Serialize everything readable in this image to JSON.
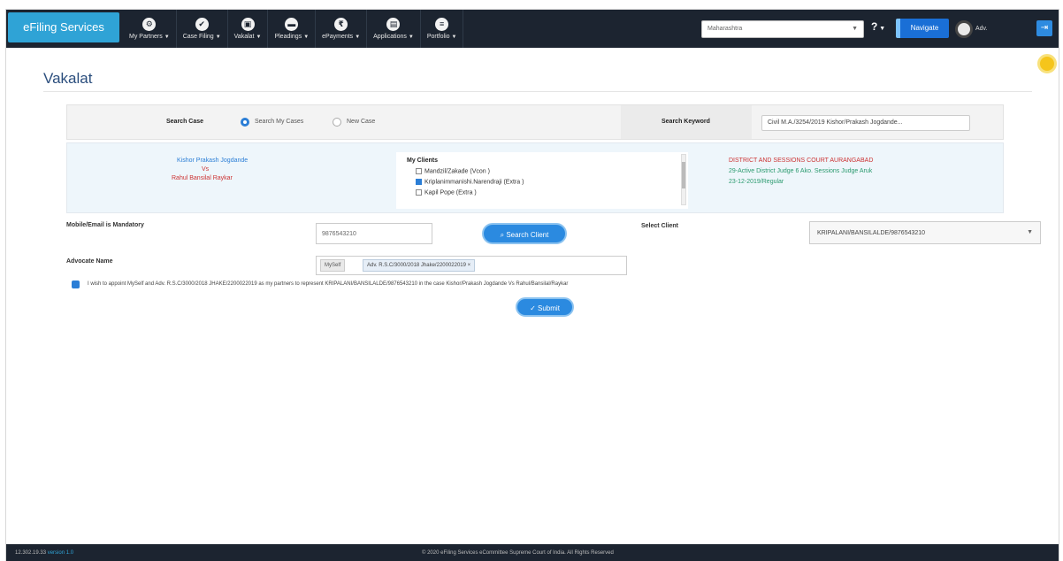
{
  "navbar": {
    "brand": "eFiling Services",
    "menu": [
      {
        "icon": "briefcase-icon",
        "glyph": "⚙",
        "label": "My Partners"
      },
      {
        "icon": "check-icon",
        "glyph": "✔",
        "label": "Case Filing"
      },
      {
        "icon": "document-icon",
        "glyph": "▣",
        "label": "Vakalat"
      },
      {
        "icon": "gavel-icon",
        "glyph": "▬",
        "label": "Pleadings"
      },
      {
        "icon": "rupee-icon",
        "glyph": "₹",
        "label": "ePayments"
      },
      {
        "icon": "application-icon",
        "glyph": "▤",
        "label": "Applications"
      },
      {
        "icon": "portfolio-icon",
        "glyph": "≡",
        "label": "Portfolio"
      }
    ],
    "establishment_select": "Maharashtra",
    "help_label": "?",
    "navigate_label": "Navigate",
    "user_name": "Adv.",
    "expand_label": "⇥"
  },
  "page": {
    "title": "Vakalat"
  },
  "search_bar": {
    "label": "Search Case",
    "option_search_my_cases": "Search My Cases",
    "option_new_case": "New Case",
    "keyword_label": "Search Keyword",
    "keyword_value": "Civil M.A./3254/2019 Kishor/Prakash Jogdande..."
  },
  "case_info": {
    "party1": "Kishor Prakash Jogdande",
    "vs": "Vs",
    "party2": "Rahul Bansilal Raykar",
    "clients_title": "My Clients",
    "clients": [
      {
        "label": "Mandzil/Zakade (Vcon )",
        "checked": false
      },
      {
        "label": "Kriplanimmanishi.Narendraji (Extra )",
        "checked": true
      },
      {
        "label": "Kapil Pope (Extra )",
        "checked": false
      }
    ],
    "court_name": "DISTRICT AND SESSIONS COURT AURANGABAD",
    "court_line1": "29-Active District Judge 6 Ako. Sessions Judge Aruk",
    "court_line2": "23-12-2019/Regular"
  },
  "form": {
    "mobile_label": "Mobile/Email is Mandatory",
    "mobile_value": "9876543210",
    "search_client_label": "Search Client",
    "select_client_label": "Select Client",
    "select_client_value": "KRIPALANI/BANSILALDE/9876543210",
    "advocate_label": "Advocate Name",
    "advocate_prefix": "MySelf",
    "advocate_tag": "Adv. R.S.C/3000/2018 Jhake/2200022019",
    "advocate_tag_close": "×",
    "consent_text": "I wish to appoint MySelf and Adv. R.S.C/3000/2018 JHAKE/2200022019 as my partners to represent KRIPALANI/BANSILALDE/9876543210 in the case Kishor/Prakash Jogdande Vs Rahul/Bansilal/Raykar",
    "submit_label": "Submit"
  },
  "footer": {
    "left_time": "12.302.19.33",
    "version": "version 1.0",
    "center": "© 2020 eFiling Services eCommittee Supreme Court of India. All Rights Reserved"
  },
  "colors": {
    "navbar_bg": "#1c2430",
    "brand_bg": "#2fa3d6",
    "accent": "#2b7ed6",
    "title": "#2b4e7d",
    "danger": "#cc3333",
    "success": "#2a9a6e"
  }
}
